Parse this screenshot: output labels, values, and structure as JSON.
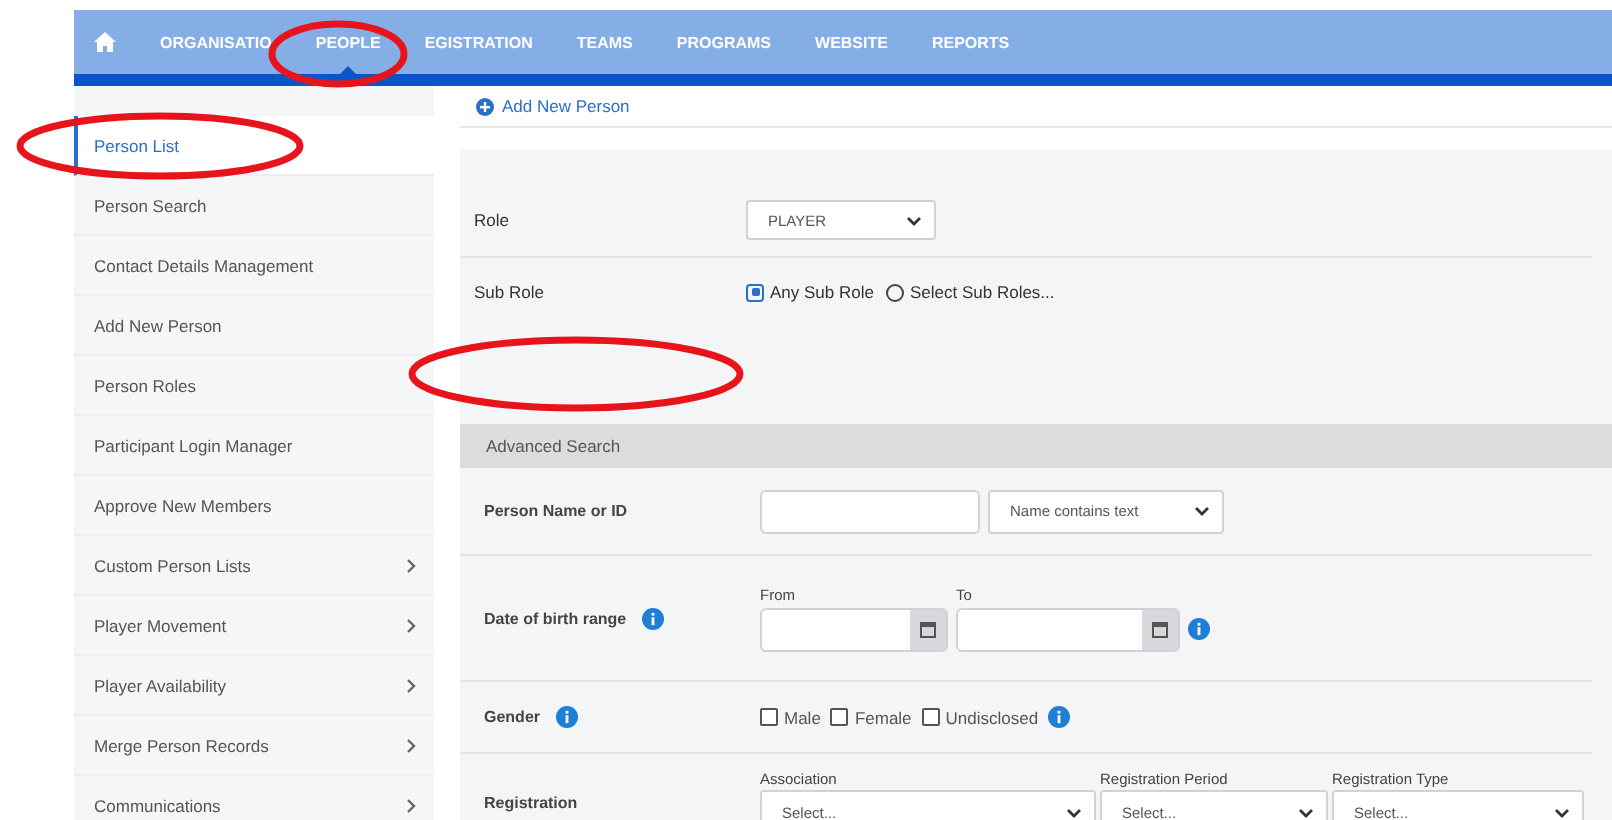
{
  "nav": {
    "items": [
      {
        "label": "ORGANISATIO",
        "selected": false
      },
      {
        "label": "PEOPLE",
        "selected": true
      },
      {
        "label": "EGISTRATION",
        "selected": false
      },
      {
        "label": "TEAMS",
        "selected": false
      },
      {
        "label": "PROGRAMS",
        "selected": false
      },
      {
        "label": "WEBSITE",
        "selected": false
      },
      {
        "label": "REPORTS",
        "selected": false
      }
    ]
  },
  "sidebar": {
    "items": [
      {
        "label": "Person List",
        "selected": true,
        "has_submenu": false
      },
      {
        "label": "Person Search",
        "selected": false,
        "has_submenu": false
      },
      {
        "label": "Contact Details Management",
        "selected": false,
        "has_submenu": false
      },
      {
        "label": "Add New Person",
        "selected": false,
        "has_submenu": false
      },
      {
        "label": "Person Roles",
        "selected": false,
        "has_submenu": false
      },
      {
        "label": "Participant Login Manager",
        "selected": false,
        "has_submenu": false
      },
      {
        "label": "Approve New Members",
        "selected": false,
        "has_submenu": false
      },
      {
        "label": "Custom Person Lists",
        "selected": false,
        "has_submenu": true
      },
      {
        "label": "Player Movement",
        "selected": false,
        "has_submenu": true
      },
      {
        "label": "Player Availability",
        "selected": false,
        "has_submenu": true
      },
      {
        "label": "Merge Person Records",
        "selected": false,
        "has_submenu": true
      },
      {
        "label": "Communications",
        "selected": false,
        "has_submenu": true
      }
    ]
  },
  "add_link": "Add New Person",
  "role": {
    "label": "Role",
    "value": "PLAYER"
  },
  "sub_role": {
    "label": "Sub Role",
    "options": [
      {
        "label": "Any Sub Role",
        "selected": true
      },
      {
        "label": "Select Sub Roles...",
        "selected": false
      }
    ]
  },
  "advanced_search": {
    "title": "Advanced Search",
    "name": {
      "label": "Person Name or ID",
      "match": "Name contains text"
    },
    "dob": {
      "label": "Date of birth range",
      "from_label": "From",
      "to_label": "To"
    },
    "gender": {
      "label": "Gender",
      "options": [
        {
          "label": "Male",
          "checked": false
        },
        {
          "label": "Female",
          "checked": false
        },
        {
          "label": "Undisclosed",
          "checked": false
        }
      ]
    },
    "registration": {
      "label": "Registration",
      "selects": [
        {
          "label": "Association",
          "value": "Select..."
        },
        {
          "label": "Registration Period",
          "value": "Select..."
        },
        {
          "label": "Registration Type",
          "value": "Select..."
        }
      ]
    }
  },
  "annotations": [
    {
      "kind": "ellipse"
    },
    {
      "kind": "ellipse"
    },
    {
      "kind": "ellipse"
    }
  ]
}
